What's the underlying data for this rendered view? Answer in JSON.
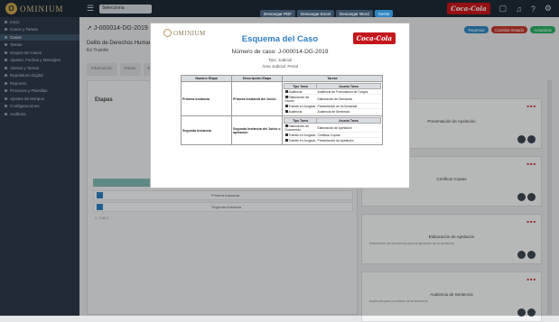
{
  "app": {
    "logo_text": "OMINIUM",
    "logo_letter": "O",
    "brand": "Coca-Cola",
    "selector_value": "Selecciona"
  },
  "sidebar": {
    "items": [
      {
        "label": "Inicio"
      },
      {
        "label": "Casos y Tareas"
      },
      {
        "label": "Casos",
        "active": true
      },
      {
        "label": "Tareas"
      },
      {
        "label": "Grupos de Casos"
      },
      {
        "label": "Ajustes, Fechas y Mensajes"
      },
      {
        "label": "Alertas y Tareas"
      },
      {
        "label": "Repositorio Digital"
      },
      {
        "label": "Reportes"
      },
      {
        "label": "Procesos y Plantillas"
      },
      {
        "label": "Ajustes de tiempos"
      },
      {
        "label": "Configuraciones"
      },
      {
        "label": "Auditoria"
      }
    ]
  },
  "main": {
    "crumb": "J-000014-DG-2019",
    "case_title": "Delito de Derechos Humanos",
    "case_sub": "En Tramite",
    "buttons": [
      {
        "label": "Regresar",
        "color": "#2e86c1"
      },
      {
        "label": "Cambiar Estado",
        "color": "#c0392b"
      },
      {
        "label": "Actualizar",
        "color": "#27ae60"
      }
    ],
    "tabs": [
      "Información",
      "Partes",
      "Etapas",
      "",
      "",
      "",
      "",
      "",
      "Documentos",
      "Notas",
      "Bitácora"
    ],
    "left_panel_title": "Etapas",
    "left_rows": [
      {
        "label": "Primera Instancia"
      },
      {
        "label": "Segunda Instancia"
      }
    ],
    "left_footer": "1 - 2 de 2"
  },
  "cards": [
    {
      "title": "Presentación de Apelación",
      "sub": "Recurso de apelación"
    },
    {
      "title": "Certificar Copias",
      "sub": "Certificación de copias"
    },
    {
      "title": "Elaboración de Apelación",
      "sub": "Elaboración de documento para la apelación de la sentencia"
    },
    {
      "title": "Audiencia de Sentencia",
      "sub": "Audiencia para la emisión de la sentencia"
    }
  ],
  "modal": {
    "toolbar": [
      "Descargar PDF",
      "Descargar Excel",
      "Descargar Word",
      "Cerrar"
    ],
    "logo_text": "OMINIUM",
    "title": "Esquema del Caso",
    "case_number": "Número de caso: J-000014-DG-2019",
    "type": "Tipo: Judicial",
    "area": "Área Judicial: Penal",
    "headers": [
      "Nombre Etapa",
      "Descripción Etapa",
      "Tareas"
    ],
    "inner_headers": [
      "Tipo Tarea",
      "Asunto Tarea"
    ],
    "stages": [
      {
        "name": "Primera Instancia",
        "desc": "Primera Instancia del Juicio",
        "tasks": [
          {
            "type": "Audiencia",
            "subject": "Audiencia de Formulación de Cargos"
          },
          {
            "type": "Elaboración de Escrito",
            "subject": "Elaboración de Demanda"
          },
          {
            "type": "Trámite en Juzgado",
            "subject": "Presentación de la Demanda"
          },
          {
            "type": "Audiencia",
            "subject": "Audiencia de Sentencia"
          }
        ]
      },
      {
        "name": "Segunda Instancia",
        "desc": "Segunda Instancia del Juicio o apelación",
        "tasks": [
          {
            "type": "Elaboración de Documento",
            "subject": "Elaboración de Apelación"
          },
          {
            "type": "Trámite en Juzgado",
            "subject": "Certificar Copias"
          },
          {
            "type": "Trámite en Juzgado",
            "subject": "Presentación de Apelación"
          }
        ]
      }
    ]
  }
}
